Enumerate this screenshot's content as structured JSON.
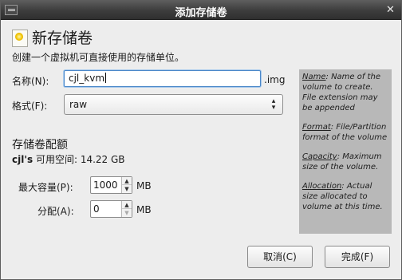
{
  "window": {
    "title": "添加存储卷"
  },
  "header": {
    "title": "新存储卷",
    "subtitle": "创建一个虚拟机可直接使用的存储单位。"
  },
  "form": {
    "name_label": "名称(N):",
    "name_value": "cjl_kvm",
    "name_suffix": ".img",
    "format_label": "格式(F):",
    "format_value": "raw"
  },
  "allocation_section": {
    "title": "存储卷配额",
    "owner": "cjl's",
    "free_label": " 可用空间: 14.22 GB",
    "max_capacity_label": "最大容量(P):",
    "max_capacity_value": "1000",
    "max_capacity_unit": "MB",
    "allocation_label": "分配(A):",
    "allocation_value": "0",
    "allocation_unit": "MB"
  },
  "help": {
    "name_term": "Name",
    "name_text": ": Name of the volume to create. File extension may be appended",
    "format_term": "Format",
    "format_text": ": File/Partition format of the volume",
    "capacity_term": "Capacity",
    "capacity_text": ": Maximum size of the volume.",
    "allocation_term": "Allocation",
    "allocation_text": ": Actual size allocated to volume at this time."
  },
  "buttons": {
    "cancel_label": "取消(C)",
    "finish_label": "完成(F)"
  },
  "icons": {
    "window_menu": "window-menu-icon",
    "close": "close-icon",
    "new_volume": "new-volume-icon"
  },
  "colors": {
    "titlebar": "#3e3e3e",
    "dialog_bg": "#ededed",
    "help_bg": "#b8b8b8",
    "focus": "#4b88c9"
  }
}
